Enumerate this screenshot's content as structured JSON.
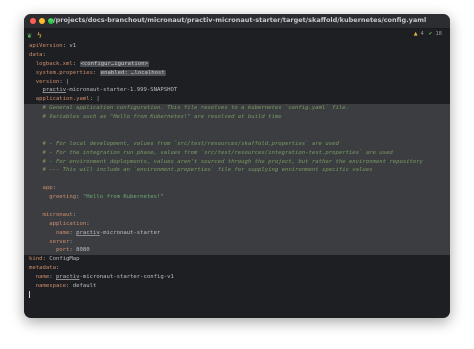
{
  "window": {
    "title": "~/projects/docs-branchout/micronaut/practiv-micronaut-starter/target/skaffold/kubernetes/config.yaml"
  },
  "toolbar": {
    "icons": [
      "leaf-icon",
      "lightning-icon"
    ],
    "inspections": {
      "warnings": "4",
      "ok": "18"
    }
  },
  "editor": {
    "lines": [
      [
        {
          "t": "apiVersion",
          "c": "k"
        },
        {
          "t": ": v1",
          "c": "v"
        }
      ],
      [
        {
          "t": "data",
          "c": "k"
        },
        {
          "t": ":",
          "c": "v"
        }
      ],
      [
        {
          "t": "  logback.xml",
          "c": "k"
        },
        {
          "t": ": ",
          "c": "v"
        },
        {
          "t": "<configur…iguration>",
          "c": "ph"
        }
      ],
      [
        {
          "t": "  system.properties",
          "c": "k"
        },
        {
          "t": ": ",
          "c": "v"
        },
        {
          "t": "enabled: …localhost",
          "c": "ph"
        }
      ],
      [
        {
          "t": "  version",
          "c": "k"
        },
        {
          "t": ": |",
          "c": "v"
        }
      ],
      [
        {
          "t": "    ",
          "c": "v"
        },
        {
          "t": "practiv",
          "c": "u"
        },
        {
          "t": "-micronaut-starter-1.999-SNAPSHOT",
          "c": "v"
        }
      ],
      [
        {
          "t": "  application.yaml",
          "c": "k"
        },
        {
          "t": ": |",
          "c": "v"
        }
      ],
      [
        {
          "t": "    # General application configuration. This file resolves to a kubernetes `config.yaml` file.",
          "c": "c",
          "hl": true
        }
      ],
      [
        {
          "t": "    # Variables such as \"Hello from Kubernetes!\" are resolved at build time",
          "c": "c",
          "hl": true
        }
      ],
      [
        {
          "t": "",
          "c": "v",
          "hl": true
        }
      ],
      [
        {
          "t": "",
          "c": "v",
          "hl": true
        }
      ],
      [
        {
          "t": "    # - For local development, values from `src/test/resources/skaffold.properties` are used",
          "c": "c",
          "hl": true
        }
      ],
      [
        {
          "t": "    # - For the integration run phase, values from `src/test/resources/integration-test.properties` are used",
          "c": "c",
          "hl": true
        }
      ],
      [
        {
          "t": "    # - For environment deployments, values aren't sourced through the project, but rather the environment repository",
          "c": "c",
          "hl": true
        }
      ],
      [
        {
          "t": "    # --- This will include an `environment.properties` file for supplying environment specific values",
          "c": "c",
          "hl": true
        }
      ],
      [
        {
          "t": "",
          "c": "v",
          "hl": true
        }
      ],
      [
        {
          "t": "    app",
          "c": "k",
          "hl": true
        },
        {
          "t": ":",
          "c": "v"
        }
      ],
      [
        {
          "t": "      greeting",
          "c": "k",
          "hl": true
        },
        {
          "t": ": ",
          "c": "v"
        },
        {
          "t": "\"Hello from Kubernetes!\"",
          "c": "s"
        }
      ],
      [
        {
          "t": "",
          "c": "v",
          "hl": true
        }
      ],
      [
        {
          "t": "    micronaut",
          "c": "k",
          "hl": true
        },
        {
          "t": ":",
          "c": "v"
        }
      ],
      [
        {
          "t": "      application",
          "c": "k",
          "hl": true
        },
        {
          "t": ":",
          "c": "v"
        }
      ],
      [
        {
          "t": "        name",
          "c": "k",
          "hl": true
        },
        {
          "t": ": ",
          "c": "v"
        },
        {
          "t": "practiv",
          "c": "u"
        },
        {
          "t": "-micronaut-starter",
          "c": "v"
        }
      ],
      [
        {
          "t": "      server",
          "c": "k",
          "hl": true
        },
        {
          "t": ":",
          "c": "v"
        }
      ],
      [
        {
          "t": "        port",
          "c": "k",
          "hl": true
        },
        {
          "t": ": 8080",
          "c": "v"
        }
      ],
      [
        {
          "t": "kind",
          "c": "k"
        },
        {
          "t": ": ConfigMap",
          "c": "v"
        }
      ],
      [
        {
          "t": "metadata",
          "c": "k"
        },
        {
          "t": ":",
          "c": "v"
        }
      ],
      [
        {
          "t": "  name",
          "c": "k"
        },
        {
          "t": ": ",
          "c": "v"
        },
        {
          "t": "practiv",
          "c": "u"
        },
        {
          "t": "-micronaut-starter-config-v1",
          "c": "v"
        }
      ],
      [
        {
          "t": "  namespace",
          "c": "k"
        },
        {
          "t": ": default",
          "c": "v"
        }
      ],
      [
        {
          "t": "",
          "c": "v",
          "caret": true
        }
      ]
    ]
  }
}
